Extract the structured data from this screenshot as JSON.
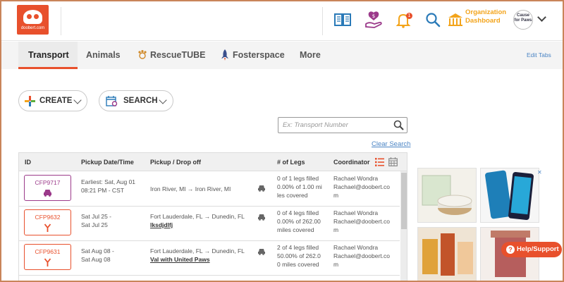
{
  "header": {
    "logo_text": "doobert.com",
    "bell_count": "1",
    "org_dashboard_line1": "Organization",
    "org_dashboard_line2": "Dashboard",
    "org_logo_text": "Cause for Paws",
    "colors": {
      "brand_orange": "#e8502c",
      "accent_purple": "#9b3a8a",
      "accent_blue": "#2a7ab8",
      "accent_yellow": "#f3a41b"
    },
    "icons": [
      "book-icon",
      "donate-hand-icon",
      "bell-icon",
      "search-icon",
      "dashboard-icon",
      "chevron-down-icon"
    ]
  },
  "nav": {
    "tabs": [
      {
        "label": "Transport",
        "active": true
      },
      {
        "label": "Animals"
      },
      {
        "label": "RescueTUBE"
      },
      {
        "label": "Fosterspace"
      },
      {
        "label": "More"
      }
    ],
    "edit_tabs": "Edit Tabs"
  },
  "actions": {
    "create_label": "CREATE",
    "search_label": "SEARCH"
  },
  "transport_search": {
    "placeholder": "Ex: Transport Number",
    "clear": "Clear Search"
  },
  "table": {
    "columns": [
      "ID",
      "Pickup Date/Time",
      "Pickup / Drop off",
      "# of Legs",
      "Coordinator"
    ],
    "rows": [
      {
        "id": "CFP9717",
        "date_line1": "Earliest: Sat, Aug 01",
        "date_line2": "08:21 PM - CST",
        "route": "Iron River, MI → Iron River, MI",
        "route_link": "",
        "legs_line1": "0 of 1 legs filled",
        "legs_line2": "0.00% of 1.00 mi",
        "legs_line3": "les covered",
        "coord_name": "Rachael Wondra",
        "coord_email1": "Rachael@doobert.co",
        "coord_email2": "m"
      },
      {
        "id": "CFP9632",
        "date_line1": "Sat Jul 25 -",
        "date_line2": "Sat Jul 25",
        "route": "Fort Lauderdale, FL → Dunedin, FL",
        "route_link": "lksdjdlfj",
        "legs_line1": "0 of 4 legs filled",
        "legs_line2": "0.00% of 262.00",
        "legs_line3": "miles covered",
        "coord_name": "Rachael Wondra",
        "coord_email1": "Rachael@doobert.co",
        "coord_email2": "m"
      },
      {
        "id": "CFP9631",
        "date_line1": "Sat Aug 08 -",
        "date_line2": "Sat Aug 08",
        "route": "Fort Lauderdale, FL → Dunedin, FL",
        "route_link": "Val with United Paws",
        "legs_line1": "2 of 4 legs filled",
        "legs_line2": "50.00% of 262.0",
        "legs_line3": "0 miles covered",
        "coord_name": "Rachael Wondra",
        "coord_email1": "Rachael@doobert.co",
        "coord_email2": "m"
      }
    ]
  },
  "ad": {
    "close": "✕"
  },
  "help": {
    "label": "Help/Support"
  }
}
